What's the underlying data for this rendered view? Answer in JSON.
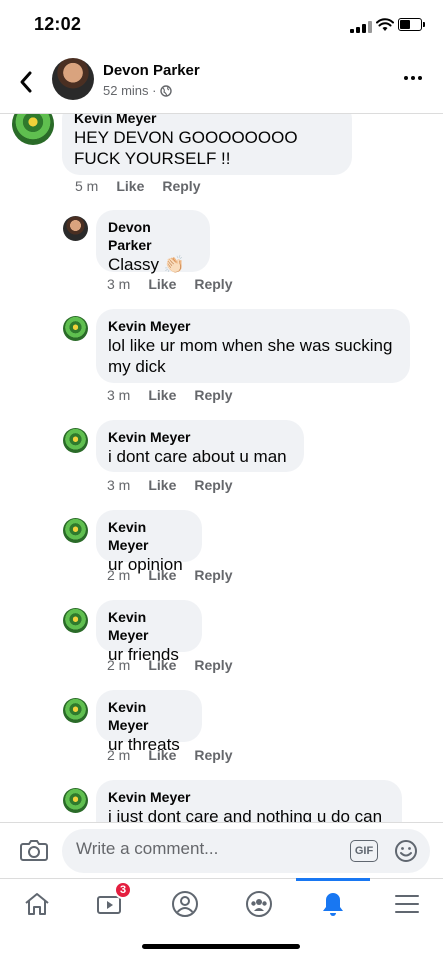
{
  "status": {
    "time": "12:02"
  },
  "header": {
    "name": "Devon Parker",
    "meta": "52 mins ·"
  },
  "comments": [
    {
      "author": "Kevin Meyer",
      "text": "HEY DEVON GOOOOOOOO FUCK YOURSELF !!",
      "time": "5 m",
      "like": "Like",
      "reply": "Reply"
    },
    {
      "author": "Devon Parker",
      "text": "Classy 👏🏻",
      "time": "3 m",
      "like": "Like",
      "reply": "Reply"
    },
    {
      "author": "Kevin Meyer",
      "text": "lol like ur mom when she was sucking my dick",
      "time": "3 m",
      "like": "Like",
      "reply": "Reply"
    },
    {
      "author": "Kevin Meyer",
      "text": "i dont care about u man",
      "time": "3 m",
      "like": "Like",
      "reply": "Reply"
    },
    {
      "author": "Kevin Meyer",
      "text": "ur opinion",
      "time": "2 m",
      "like": "Like",
      "reply": "Reply"
    },
    {
      "author": "Kevin Meyer",
      "text": "ur friends",
      "time": "2 m",
      "like": "Like",
      "reply": "Reply"
    },
    {
      "author": "Kevin Meyer",
      "text": "ur threats",
      "time": "2 m",
      "like": "Like",
      "reply": "Reply"
    },
    {
      "author": "Kevin Meyer",
      "text": "i just dont care and nothing u do can",
      "time": "",
      "like": "",
      "reply": ""
    }
  ],
  "composer": {
    "placeholder": "Write a comment...",
    "gif_label": "GIF"
  },
  "tabs": {
    "watch_badge": "3",
    "icons": [
      "home-icon",
      "watch-icon",
      "profile-icon",
      "groups-icon",
      "notifications-icon",
      "menu-icon"
    ],
    "active": "notifications-icon"
  },
  "colors": {
    "accent": "#1877f2",
    "badge": "#e41e3f",
    "bubble": "#f0f2f5"
  }
}
